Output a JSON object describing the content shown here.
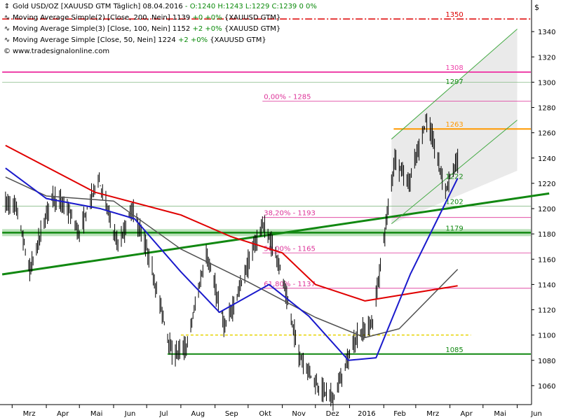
{
  "legend": {
    "title": "Gold USD/OZ [XAUUSD GTM  Täglich] 08.04.2016",
    "title_ohlc": "- O:1240 H:1243 L:1229 C:1239 0 0%",
    "ma200_label": "Moving Average Simple(2) [Close, 200, Nein]",
    "ma200_value": "1139",
    "ma200_change": "+0 +0%",
    "ma200_src": "{XAUUSD GTM}",
    "ma100_label": "Moving Average Simple(3) [Close, 100, Nein]",
    "ma100_value": "1152",
    "ma100_change": "+2 +0%",
    "ma100_src": "{XAUUSD GTM}",
    "ma50_label": "Moving Average Simple [Close, 50, Nein]",
    "ma50_value": "1224",
    "ma50_change": "+2 +0%",
    "ma50_src": "{XAUUSD GTM}",
    "source": "www.tradesignalonline.com"
  },
  "currency_symbol": "$",
  "colors": {
    "ma200": "#e00000",
    "ma100": "#505050",
    "ma50": "#1a1acc",
    "trendline": "#118811",
    "channel": "#44aa44",
    "fib": "#dd3399",
    "level_1308": "#ee44aa",
    "level_1263": "#ff9900",
    "level_1350": "#dd0000",
    "support_1179": "#118811",
    "level_1100": "#e6d300"
  },
  "chart_data": {
    "type": "candlestick",
    "title": "Gold USD/OZ [XAUUSD GTM  Täglich] 08.04.2016",
    "ylim": [
      1045,
      1365
    ],
    "y_ticks": [
      1060,
      1080,
      1100,
      1120,
      1140,
      1160,
      1180,
      1200,
      1220,
      1240,
      1260,
      1280,
      1300,
      1320,
      1340
    ],
    "x_tick_labels": [
      "Mrz",
      "Apr",
      "Mai",
      "Jun",
      "Jul",
      "Aug",
      "Sep",
      "Okt",
      "Nov",
      "Dez",
      "2016",
      "Feb",
      "Mrz",
      "Apr",
      "Mai",
      "Jun"
    ],
    "last_bar": {
      "date": "08.04.2016",
      "open": 1240,
      "high": 1243,
      "low": 1229,
      "close": 1239
    },
    "price_path": [
      {
        "date": "2015-02-23",
        "price": 1205
      },
      {
        "date": "2015-03-05",
        "price": 1200
      },
      {
        "date": "2015-03-17",
        "price": 1150
      },
      {
        "date": "2015-04-06",
        "price": 1210
      },
      {
        "date": "2015-04-20",
        "price": 1200
      },
      {
        "date": "2015-05-01",
        "price": 1180
      },
      {
        "date": "2015-05-18",
        "price": 1225
      },
      {
        "date": "2015-06-05",
        "price": 1170
      },
      {
        "date": "2015-06-18",
        "price": 1200
      },
      {
        "date": "2015-07-02",
        "price": 1165
      },
      {
        "date": "2015-07-24",
        "price": 1085
      },
      {
        "date": "2015-08-06",
        "price": 1090
      },
      {
        "date": "2015-08-24",
        "price": 1165
      },
      {
        "date": "2015-09-10",
        "price": 1105
      },
      {
        "date": "2015-10-14",
        "price": 1188
      },
      {
        "date": "2015-10-28",
        "price": 1160
      },
      {
        "date": "2015-11-16",
        "price": 1085
      },
      {
        "date": "2015-12-03",
        "price": 1060
      },
      {
        "date": "2015-12-17",
        "price": 1050
      },
      {
        "date": "2016-01-07",
        "price": 1098
      },
      {
        "date": "2016-01-22",
        "price": 1110
      },
      {
        "date": "2016-02-11",
        "price": 1240
      },
      {
        "date": "2016-02-24",
        "price": 1220
      },
      {
        "date": "2016-03-11",
        "price": 1272
      },
      {
        "date": "2016-03-28",
        "price": 1215
      },
      {
        "date": "2016-04-08",
        "price": 1239
      }
    ],
    "ma200_path": [
      {
        "date": "2015-02-23",
        "price": 1250
      },
      {
        "date": "2015-05-15",
        "price": 1213
      },
      {
        "date": "2015-08-01",
        "price": 1195
      },
      {
        "date": "2015-09-15",
        "price": 1178
      },
      {
        "date": "2015-11-01",
        "price": 1165
      },
      {
        "date": "2015-12-01",
        "price": 1140
      },
      {
        "date": "2016-01-15",
        "price": 1127
      },
      {
        "date": "2016-04-08",
        "price": 1139
      }
    ],
    "ma100_path": [
      {
        "date": "2015-02-23",
        "price": 1225
      },
      {
        "date": "2015-04-01",
        "price": 1210
      },
      {
        "date": "2015-06-01",
        "price": 1206
      },
      {
        "date": "2015-08-01",
        "price": 1168
      },
      {
        "date": "2015-10-01",
        "price": 1142
      },
      {
        "date": "2015-12-01",
        "price": 1114
      },
      {
        "date": "2016-01-15",
        "price": 1098
      },
      {
        "date": "2016-02-15",
        "price": 1105
      },
      {
        "date": "2016-04-08",
        "price": 1152
      }
    ],
    "ma50_path": [
      {
        "date": "2015-02-23",
        "price": 1232
      },
      {
        "date": "2015-04-01",
        "price": 1208
      },
      {
        "date": "2015-05-20",
        "price": 1200
      },
      {
        "date": "2015-06-20",
        "price": 1192
      },
      {
        "date": "2015-08-01",
        "price": 1150
      },
      {
        "date": "2015-09-05",
        "price": 1118
      },
      {
        "date": "2015-10-20",
        "price": 1140
      },
      {
        "date": "2015-11-25",
        "price": 1115
      },
      {
        "date": "2015-12-31",
        "price": 1080
      },
      {
        "date": "2016-01-25",
        "price": 1082
      },
      {
        "date": "2016-02-25",
        "price": 1148
      },
      {
        "date": "2016-04-08",
        "price": 1224
      }
    ],
    "trendline": [
      {
        "date": "2015-02-20",
        "price": 1148
      },
      {
        "date": "2016-06-30",
        "price": 1212
      }
    ],
    "channel_upper": [
      {
        "date": "2016-02-08",
        "price": 1255
      },
      {
        "date": "2016-06-01",
        "price": 1342
      }
    ],
    "channel_lower": [
      {
        "date": "2016-02-08",
        "price": 1188
      },
      {
        "date": "2016-06-01",
        "price": 1270
      }
    ],
    "channel_box_low": [
      {
        "date": "2016-02-08",
        "price": 1188
      },
      {
        "date": "2016-06-01",
        "price": 1230
      }
    ],
    "horizontal_levels": [
      {
        "label": "1350",
        "price": 1350,
        "style": "dashdot",
        "color_key": "level_1350",
        "from": "2015-02-20",
        "to": "2016-06-30"
      },
      {
        "label": "1308",
        "price": 1308,
        "style": "solid",
        "color_key": "level_1308",
        "from": "2015-02-20",
        "to": "2016-06-30"
      },
      {
        "label": "1297",
        "price": 1300,
        "style": "thin",
        "color_key": "channel",
        "from": "2015-02-20",
        "to": "2016-06-30",
        "label_price": 1297
      },
      {
        "label": "0,00% - 1285",
        "price": 1285,
        "style": "fib",
        "color_key": "fib",
        "from": "2015-10-14",
        "to": "2016-06-30"
      },
      {
        "label": "1263",
        "price": 1263,
        "style": "solid",
        "color_key": "level_1263",
        "from": "2016-02-10",
        "to": "2016-06-30"
      },
      {
        "label": "1222",
        "price": 1222,
        "style": "none",
        "color_key": "support_1179",
        "from": "2016-04-01",
        "to": "2016-04-01"
      },
      {
        "label": "1202",
        "price": 1202,
        "style": "thin",
        "color_key": "channel",
        "from": "2015-02-20",
        "to": "2016-06-30"
      },
      {
        "label": "38,20% - 1193",
        "price": 1193,
        "style": "fib",
        "color_key": "fib",
        "from": "2015-10-14",
        "to": "2016-06-30"
      },
      {
        "label": "1179",
        "price": 1181,
        "style": "band",
        "color_key": "support_1179",
        "from": "2015-02-20",
        "to": "2016-06-30"
      },
      {
        "label": "50,00% - 1165",
        "price": 1165,
        "style": "fib",
        "color_key": "fib",
        "from": "2015-10-14",
        "to": "2016-06-30"
      },
      {
        "label": "61,80% - 1137",
        "price": 1137,
        "style": "fib",
        "color_key": "fib",
        "from": "2015-10-14",
        "to": "2016-06-30"
      },
      {
        "label": "",
        "price": 1100,
        "style": "dashed",
        "color_key": "level_1100",
        "from": "2015-08-01",
        "to": "2016-04-20"
      },
      {
        "label": "1085",
        "price": 1085,
        "style": "thick",
        "color_key": "support_1179",
        "from": "2015-07-20",
        "to": "2016-06-30"
      }
    ]
  }
}
